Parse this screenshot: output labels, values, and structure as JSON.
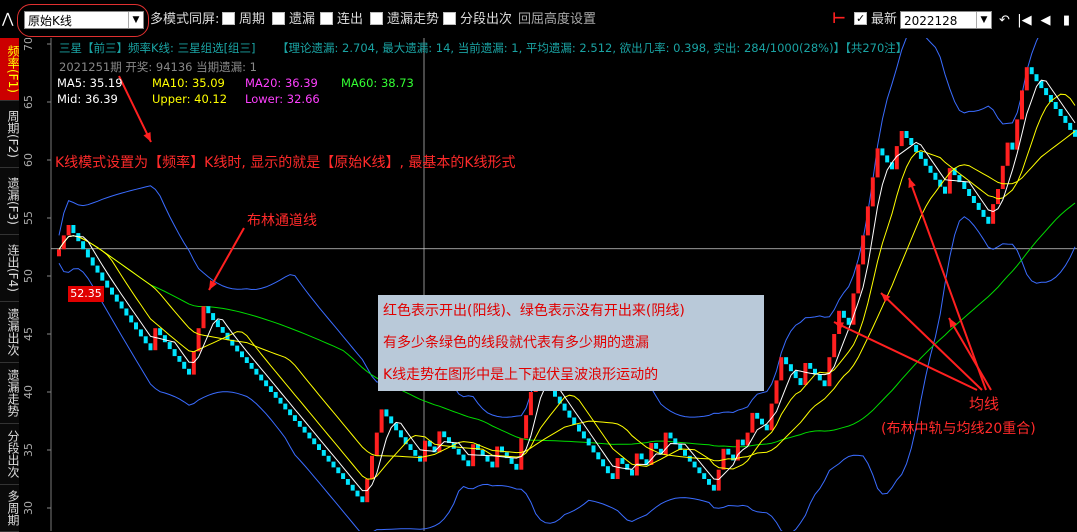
{
  "colors": {
    "up": "#ff2020",
    "down": "#00e5ff",
    "ma5": "#ffffff",
    "ma10": "#ffff00",
    "mid": "#ffff00",
    "ma60": "#00dd00",
    "boll": "#3a6cff",
    "annotation": "#ff2020",
    "note_box": "#b9c9d9",
    "cyan_text": "#1aa3a3"
  },
  "toolbar": {
    "mode_select": "原始K线",
    "multi_mode_label": "多模式同屏:",
    "checkboxes": [
      {
        "label": "周期",
        "checked": false
      },
      {
        "label": "遗漏",
        "checked": false
      },
      {
        "label": "连出",
        "checked": false
      },
      {
        "label": "遗漏走势",
        "checked": false
      },
      {
        "label": "分段出次",
        "checked": false
      }
    ],
    "height_setting": "回屈高度设置",
    "latest_label": "最新",
    "latest_checked": true,
    "period_select": "2022128",
    "nav_icons": [
      "return-icon",
      "first-icon",
      "prev-icon",
      "next-icon"
    ]
  },
  "left_tabs": [
    {
      "label": "频率(F1)",
      "active": true
    },
    {
      "label": "周期(F2)",
      "active": false
    },
    {
      "label": "遗漏(F3)",
      "active": false
    },
    {
      "label": "连出(F4)",
      "active": false
    },
    {
      "label": "遗漏出次",
      "active": false
    },
    {
      "label": "遗漏走势",
      "active": false
    },
    {
      "label": "分段出次",
      "active": false
    },
    {
      "label": "多周期",
      "active": false
    }
  ],
  "info": {
    "line1a": "三星【前三】频率K线: 三星组选[组三]",
    "line1b": "【理论遗漏: 2.704, 最大遗漏: 14, 当前遗漏: 1, 平均遗漏: 2.512, 欲出几率: 0.398, 实出: 284/1000(28%)】【共270注】",
    "line2": "2021251期 开奖: 94136 当期遗漏: 1",
    "ma5": "MA5: 35.19",
    "ma10": "MA10: 35.09",
    "ma20": "MA20: 36.39",
    "ma60": "MA60: 38.73",
    "mid": "Mid: 36.39",
    "upper": "Upper: 40.12",
    "lower": "Lower: 32.66"
  },
  "y_axis": {
    "min": 30,
    "max": 70,
    "ticks": [
      "70",
      "65",
      "60",
      "55",
      "50",
      "45",
      "40",
      "35",
      "30"
    ]
  },
  "last_price": "52.35",
  "annotations": {
    "kline_mode": "K线模式设置为【频率】K线时, 显示的就是【原始K线】, 最基本的K线形式",
    "boll": "布林通道线",
    "ma": "均线",
    "ma_note": "(布林中轨与均线20重合)"
  },
  "note_box": [
    "红色表示开出(阳线)、绿色表示没有开出来(阴线)",
    "有多少条绿色的线段就代表有多少期的遗漏",
    "K线走势在图形中是上下起伏呈波浪形运动的"
  ],
  "chart_data": {
    "type": "candlestick",
    "xlabel": "",
    "ylabel": "",
    "ylim": [
      30,
      70
    ],
    "series": [
      {
        "name": "K",
        "ohlc_close": [
          52.3,
          53.5,
          54.4,
          53.7,
          53.0,
          52.3,
          51.6,
          50.9,
          50.3,
          49.6,
          49.0,
          48.4,
          47.8,
          47.2,
          46.6,
          46.0,
          45.4,
          44.8,
          44.2,
          43.6,
          45.5,
          44.9,
          44.3,
          43.7,
          43.1,
          42.6,
          42.0,
          41.5,
          43.5,
          45.5,
          47.4,
          46.8,
          46.2,
          45.6,
          45.1,
          44.5,
          44.0,
          43.5,
          43.0,
          42.5,
          42.0,
          41.5,
          41.0,
          40.5,
          40.0,
          39.5,
          39.0,
          38.5,
          38.0,
          37.5,
          37.0,
          36.5,
          36.0,
          35.5,
          35.0,
          34.5,
          34.0,
          33.5,
          33.0,
          32.5,
          32.0,
          31.5,
          31.0,
          30.5,
          32.5,
          34.5,
          36.5,
          38.5,
          37.9,
          37.3,
          36.7,
          36.1,
          35.5,
          35.0,
          34.5,
          34.0,
          35.8,
          35.3,
          34.8,
          36.6,
          36.1,
          35.6,
          35.1,
          34.6,
          34.1,
          33.6,
          35.5,
          35.0,
          34.5,
          34.0,
          33.5,
          35.3,
          34.8,
          34.3,
          33.8,
          33.3,
          36.0,
          38.0,
          40.0,
          42.0,
          41.4,
          40.8,
          40.2,
          39.6,
          39.0,
          38.4,
          37.8,
          37.2,
          36.6,
          36.0,
          35.4,
          34.8,
          34.2,
          33.6,
          33.0,
          32.5,
          34.3,
          33.8,
          33.3,
          32.8,
          34.7,
          34.2,
          33.7,
          35.6,
          35.1,
          34.6,
          36.5,
          36.0,
          35.5,
          35.0,
          34.5,
          34.0,
          33.5,
          33.0,
          32.5,
          32.0,
          31.5,
          33.3,
          35.1,
          34.6,
          34.1,
          35.9,
          35.4,
          36.5,
          38.2,
          37.7,
          37.2,
          36.7,
          39.0,
          41.0,
          43.0,
          42.4,
          41.8,
          41.2,
          40.6,
          42.5,
          42.0,
          41.5,
          41.0,
          40.5,
          43.0,
          45.0,
          47.0,
          46.4,
          45.8,
          48.5,
          51.0,
          53.5,
          56.0,
          58.5,
          61.0,
          60.4,
          59.8,
          59.2,
          61.2,
          62.5,
          61.9,
          61.3,
          60.7,
          60.1,
          59.5,
          58.9,
          58.3,
          57.7,
          57.1,
          59.3,
          58.7,
          58.1,
          57.5,
          56.9,
          56.3,
          55.7,
          55.1,
          54.5,
          56.2,
          57.5,
          59.5,
          61.5,
          60.9,
          63.5,
          66.0,
          68.0,
          67.4,
          66.8,
          66.2,
          65.6,
          65.0,
          64.4,
          63.8,
          63.2,
          62.6,
          62.0
        ]
      },
      {
        "name": "MA5"
      },
      {
        "name": "MA10"
      },
      {
        "name": "MA60"
      },
      {
        "name": "Upper"
      },
      {
        "name": "Lower"
      }
    ]
  }
}
